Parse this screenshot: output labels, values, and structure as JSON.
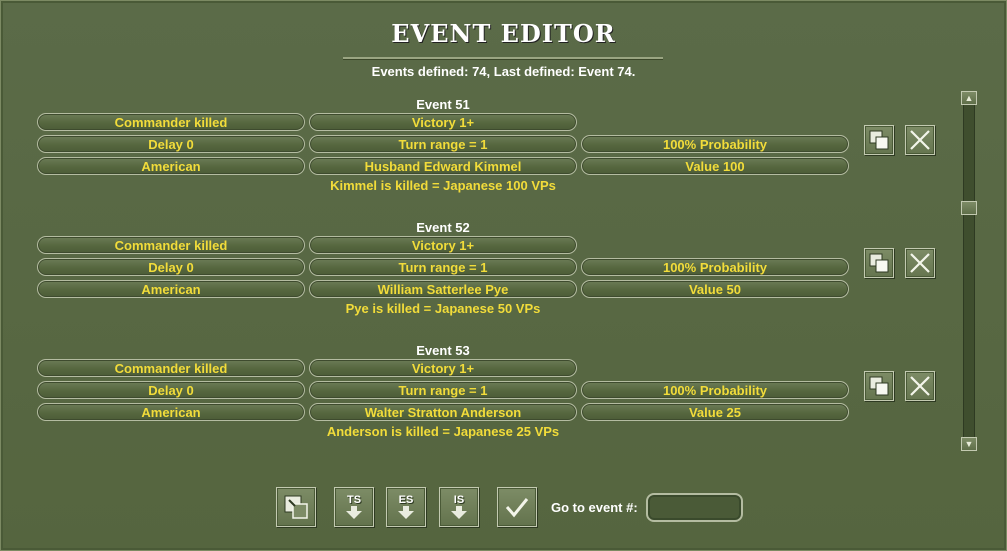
{
  "window": {
    "title": "EVENT EDITOR",
    "summary": "Events defined:  74, Last defined: Event  74."
  },
  "events": [
    {
      "title": "Event 51",
      "type": "Commander killed",
      "victory": "Victory 1+",
      "delay": "Delay 0",
      "turn_range": "Turn range = 1",
      "probability": "100% Probability",
      "side": "American",
      "commander": "Husband Edward Kimmel",
      "value": "Value 100",
      "description": "Kimmel is killed = Japanese 100 VPs"
    },
    {
      "title": "Event 52",
      "type": "Commander killed",
      "victory": "Victory 1+",
      "delay": "Delay 0",
      "turn_range": "Turn range = 1",
      "probability": "100% Probability",
      "side": "American",
      "commander": "William Satterlee Pye",
      "value": "Value 50",
      "description": "Pye is killed = Japanese 50 VPs"
    },
    {
      "title": "Event 53",
      "type": "Commander killed",
      "victory": "Victory 1+",
      "delay": "Delay 0",
      "turn_range": "Turn range = 1",
      "probability": "100% Probability",
      "side": "American",
      "commander": "Walter Stratton Anderson",
      "value": "Value 25",
      "description": "Anderson is killed = Japanese 25 VPs"
    }
  ],
  "toolbar": {
    "ts_label": "TS",
    "es_label": "ES",
    "is_label": "IS",
    "goto_label": "Go to event #:",
    "goto_value": ""
  },
  "icons": {
    "copy": "copy-icon",
    "delete": "close-icon",
    "new": "new-event-icon",
    "confirm": "checkmark-icon",
    "scroll_up": "arrow-up-icon",
    "scroll_down": "arrow-down-icon"
  },
  "colors": {
    "accent_text": "#f2dc3a",
    "panel": "#55653f"
  }
}
